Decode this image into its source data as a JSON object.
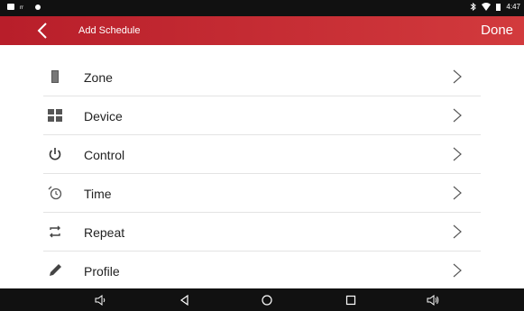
{
  "status_bar": {
    "time": "4:47"
  },
  "header": {
    "title": "Add Schedule",
    "done_label": "Done"
  },
  "colors": {
    "accent": "#c8262e"
  },
  "menu": [
    {
      "label": "Zone",
      "icon": "zone-icon"
    },
    {
      "label": "Device",
      "icon": "device-grid-icon"
    },
    {
      "label": "Control",
      "icon": "power-icon"
    },
    {
      "label": "Time",
      "icon": "alarm-clock-icon"
    },
    {
      "label": "Repeat",
      "icon": "repeat-icon"
    },
    {
      "label": "Profile",
      "icon": "pencil-icon"
    }
  ],
  "nav_bar": [
    "volume-down-icon",
    "back-triangle-icon",
    "home-circle-icon",
    "recents-square-icon",
    "volume-up-icon"
  ]
}
